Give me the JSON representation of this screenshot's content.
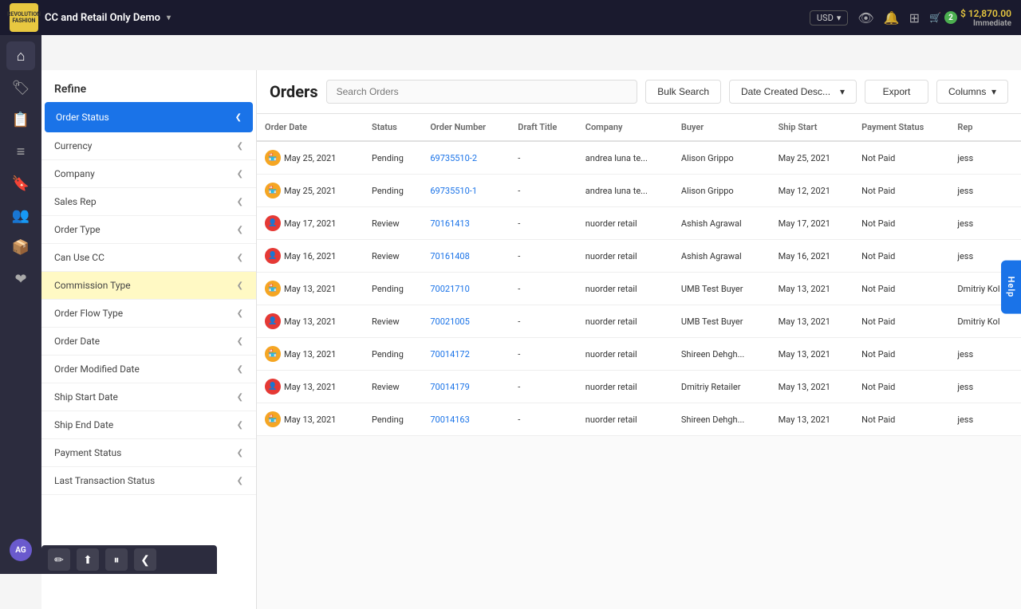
{
  "topNav": {
    "logoText": "REVOLUTION\nFASHION",
    "companyName": "CC and Retail Only Demo",
    "currency": "USD",
    "cartCount": "2",
    "cartAmount": "$ 12,870.00",
    "immediateLabel": "Immediate"
  },
  "sidebar": {
    "icons": [
      {
        "name": "home-icon",
        "glyph": "⌂"
      },
      {
        "name": "tag-icon",
        "glyph": "🏷"
      },
      {
        "name": "orders-icon",
        "glyph": "📋"
      },
      {
        "name": "list-icon",
        "glyph": "≡"
      },
      {
        "name": "bookmark-icon",
        "glyph": "🔖"
      },
      {
        "name": "users-icon",
        "glyph": "👥"
      },
      {
        "name": "box-icon",
        "glyph": "📦"
      },
      {
        "name": "heart-icon",
        "glyph": "❤"
      }
    ],
    "avatar": "AG"
  },
  "orders": {
    "title": "Orders",
    "searchPlaceholder": "Search Orders",
    "bulkSearch": "Bulk Search",
    "dateFilter": "Date Created Desc...",
    "exportLabel": "Export",
    "columnsLabel": "Columns",
    "columns": [
      "Order Date",
      "Status",
      "Order Number",
      "Draft Title",
      "Company",
      "Buyer",
      "Ship Start",
      "Payment Status",
      "Rep"
    ],
    "rows": [
      {
        "icon": "pending",
        "orderDate": "May 25, 2021",
        "status": "Pending",
        "orderNumber": "69735510-2",
        "draftTitle": "-",
        "company": "andrea luna te...",
        "buyer": "Alison Grippo",
        "shipStart": "May 25, 2021",
        "paymentStatus": "Not Paid",
        "rep": "jess"
      },
      {
        "icon": "pending",
        "orderDate": "May 25, 2021",
        "status": "Pending",
        "orderNumber": "69735510-1",
        "draftTitle": "-",
        "company": "andrea luna te...",
        "buyer": "Alison Grippo",
        "shipStart": "May 12, 2021",
        "paymentStatus": "Not Paid",
        "rep": "jess"
      },
      {
        "icon": "review",
        "orderDate": "May 17, 2021",
        "status": "Review",
        "orderNumber": "70161413",
        "draftTitle": "-",
        "company": "nuorder retail",
        "buyer": "Ashish Agrawal",
        "shipStart": "May 17, 2021",
        "paymentStatus": "Not Paid",
        "rep": "jess"
      },
      {
        "icon": "review",
        "orderDate": "May 16, 2021",
        "status": "Review",
        "orderNumber": "70161408",
        "draftTitle": "-",
        "company": "nuorder retail",
        "buyer": "Ashish Agrawal",
        "shipStart": "May 16, 2021",
        "paymentStatus": "Not Paid",
        "rep": "jess"
      },
      {
        "icon": "pending",
        "orderDate": "May 13, 2021",
        "status": "Pending",
        "orderNumber": "70021710",
        "draftTitle": "-",
        "company": "nuorder retail",
        "buyer": "UMB Test Buyer",
        "shipStart": "May 13, 2021",
        "paymentStatus": "Not Paid",
        "rep": "Dmitriy Kol"
      },
      {
        "icon": "review",
        "orderDate": "May 13, 2021",
        "status": "Review",
        "orderNumber": "70021005",
        "draftTitle": "-",
        "company": "nuorder retail",
        "buyer": "UMB Test Buyer",
        "shipStart": "May 13, 2021",
        "paymentStatus": "Not Paid",
        "rep": "Dmitriy Kol"
      },
      {
        "icon": "pending",
        "orderDate": "May 13, 2021",
        "status": "Pending",
        "orderNumber": "70014172",
        "draftTitle": "-",
        "company": "nuorder retail",
        "buyer": "Shireen Dehgh...",
        "shipStart": "May 13, 2021",
        "paymentStatus": "Not Paid",
        "rep": "jess"
      },
      {
        "icon": "review",
        "orderDate": "May 13, 2021",
        "status": "Review",
        "orderNumber": "70014179",
        "draftTitle": "-",
        "company": "nuorder retail",
        "buyer": "Dmitriy Retailer",
        "shipStart": "May 13, 2021",
        "paymentStatus": "Not Paid",
        "rep": "jess"
      },
      {
        "icon": "pending",
        "orderDate": "May 13, 2021",
        "status": "Pending",
        "orderNumber": "70014163",
        "draftTitle": "-",
        "company": "nuorder retail",
        "buyer": "Shireen Dehgh...",
        "shipStart": "May 13, 2021",
        "paymentStatus": "Not Paid",
        "rep": "jess"
      }
    ]
  },
  "refine": {
    "title": "Refine",
    "items": [
      {
        "label": "Order Status",
        "active": true
      },
      {
        "label": "Currency",
        "active": false
      },
      {
        "label": "Company",
        "active": false
      },
      {
        "label": "Sales Rep",
        "active": false
      },
      {
        "label": "Order Type",
        "active": false
      },
      {
        "label": "Can Use CC",
        "active": false
      },
      {
        "label": "Commission Type",
        "active": false,
        "highlight": true
      },
      {
        "label": "Order Flow Type",
        "active": false
      },
      {
        "label": "Order Date",
        "active": false
      },
      {
        "label": "Order Modified Date",
        "active": false
      },
      {
        "label": "Ship Start Date",
        "active": false
      },
      {
        "label": "Ship End Date",
        "active": false
      },
      {
        "label": "Payment Status",
        "active": false
      },
      {
        "label": "Last Transaction Status",
        "active": false
      }
    ]
  },
  "bottomToolbar": {
    "icons": [
      "✏",
      "⬆",
      "⏸",
      "❮"
    ]
  },
  "helpButton": "Help"
}
